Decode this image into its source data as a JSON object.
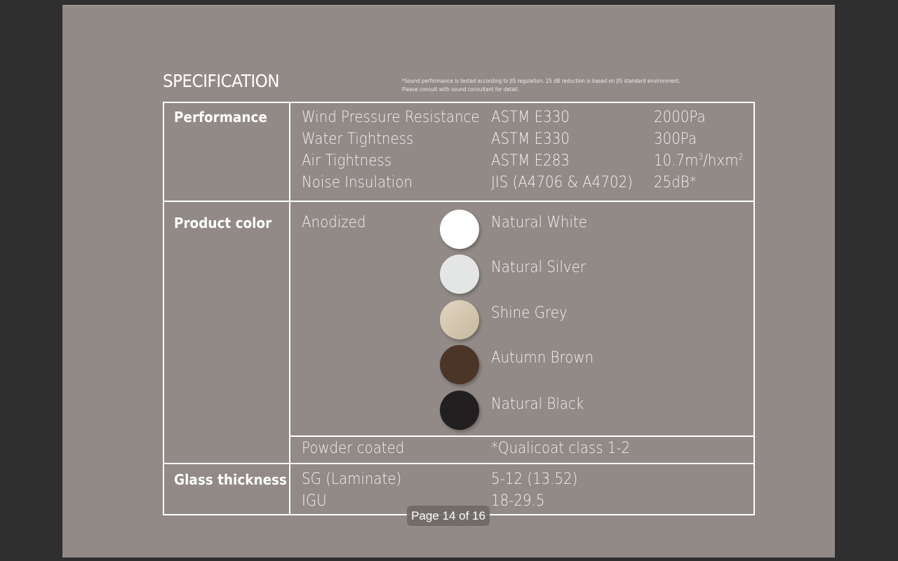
{
  "document": {
    "title": "SPECIFICATION",
    "footnote_line1": "*Sound performance is tested according to JIS regulation. 25 dB reduction is based on JIS standard environment.",
    "footnote_line2": "Please consult with sound consultant for detail."
  },
  "performance": {
    "label": "Performance",
    "rows": [
      {
        "name": "Wind Pressure Resistance",
        "standard": "ASTM E330",
        "value": "2000Pa"
      },
      {
        "name": "Water Tightness",
        "standard": "ASTM E330",
        "value": "300Pa"
      },
      {
        "name": "Air Tightness",
        "standard": "ASTM E283",
        "value_prefix": "10.7m",
        "value_sup1": "3",
        "value_mid": "/hxm",
        "value_sup2": "2"
      },
      {
        "name": "Noise Insulation",
        "standard": "JIS (A4706 & A4702)",
        "value": "25dB*"
      }
    ]
  },
  "product_color": {
    "label": "Product color",
    "finish_anodized": "Anodized",
    "colors": [
      {
        "name": "Natural White",
        "swatch": "#ffffff"
      },
      {
        "name": "Natural Silver",
        "swatch": "#e3e6e5"
      },
      {
        "name": "Shine Grey",
        "swatch": "#d4c6b0"
      },
      {
        "name": "Autumn Brown",
        "swatch": "#4b3527"
      },
      {
        "name": "Natural Black",
        "swatch": "#211f20"
      }
    ],
    "finish_powder": "Powder coated",
    "powder_note": "*Qualicoat class 1-2"
  },
  "glass_thickness": {
    "label": "Glass thickness",
    "rows": [
      {
        "type": "SG (Laminate)",
        "value": "5-12 (13.52)"
      },
      {
        "type": "IGU",
        "value": "18-29.5"
      }
    ]
  },
  "viewer": {
    "page_indicator": "Page 14 of 16"
  }
}
